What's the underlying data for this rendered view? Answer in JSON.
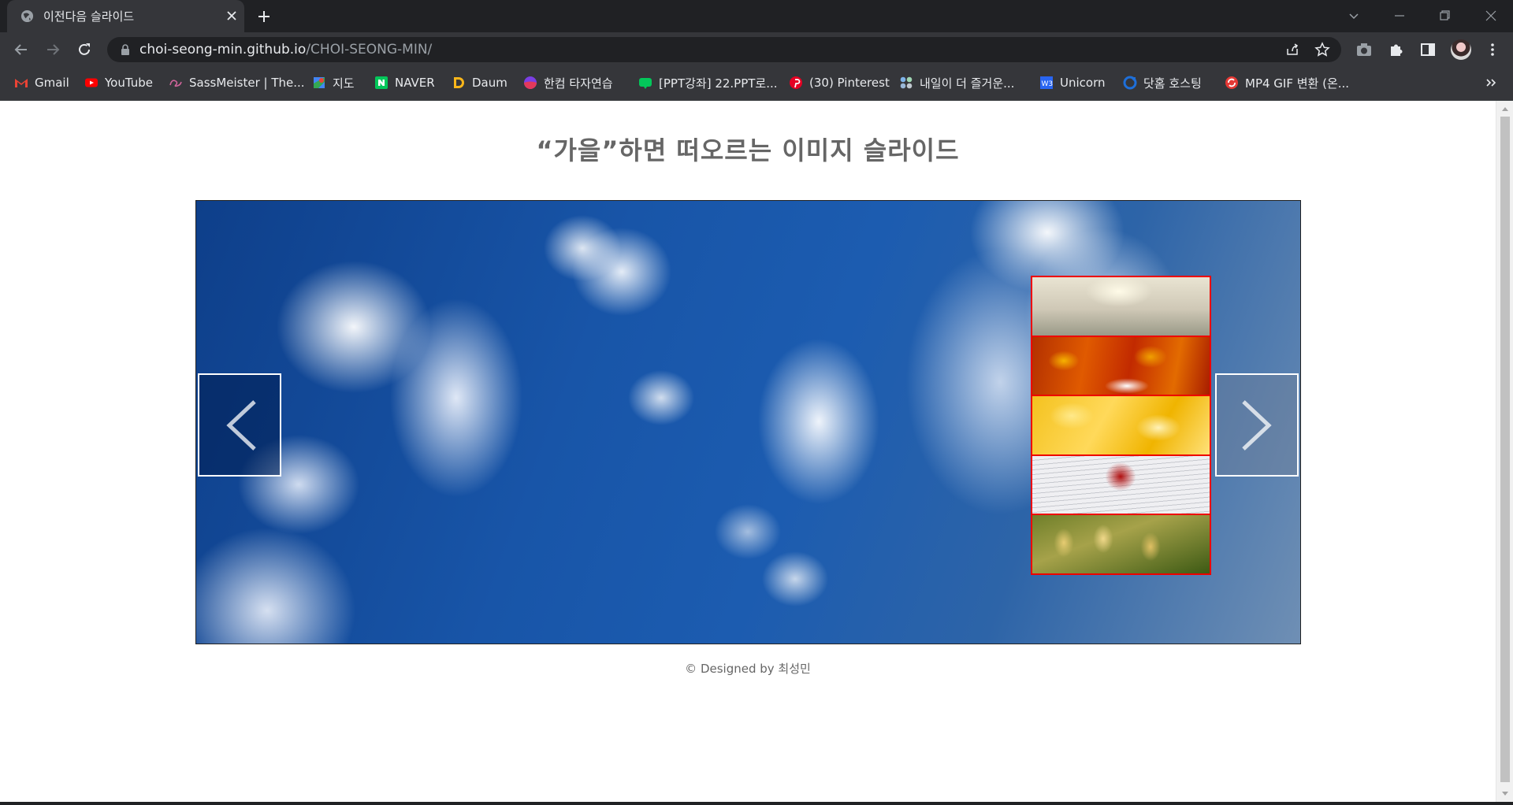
{
  "browser": {
    "tab_title": "이전다음 슬라이드",
    "url_host": "choi-seong-min.github.io",
    "url_path": "/CHOI-SEONG-MIN/",
    "bookmarks": [
      {
        "label": "Gmail",
        "icon": "gmail-icon",
        "color": "#ea4335"
      },
      {
        "label": "YouTube",
        "icon": "youtube-icon",
        "color": "#ff0000"
      },
      {
        "label": "SassMeister | The...",
        "icon": "sassmeister-icon",
        "color": "#cf649a"
      },
      {
        "label": "지도",
        "icon": "maps-icon",
        "color": "#34a853"
      },
      {
        "label": "NAVER",
        "icon": "naver-icon",
        "color": "#03c75a"
      },
      {
        "label": "Daum",
        "icon": "daum-icon",
        "color": "#f9b61a"
      },
      {
        "label": "한컴 타자연습",
        "icon": "hancom-icon",
        "color": "#7b3fe4"
      },
      {
        "label": "[PPT강좌] 22.PPT로...",
        "icon": "blog-icon",
        "color": "#03c75a"
      },
      {
        "label": "(30) Pinterest",
        "icon": "pinterest-icon",
        "color": "#e60023"
      },
      {
        "label": "내일이 더 즐거운...",
        "icon": "dots-app-icon",
        "color": "#7fb3e8"
      },
      {
        "label": "Unicorn",
        "icon": "w3-icon",
        "color": "#2965f1"
      },
      {
        "label": "닷홈 호스팅",
        "icon": "dothome-icon",
        "color": "#1e6fd9"
      },
      {
        "label": "MP4 GIF 변환 (온...",
        "icon": "convert-icon",
        "color": "#e53935"
      }
    ]
  },
  "page": {
    "title": "“가을”하면 떠오르는 이미지 슬라이드",
    "footer": "© Designed by 최성민"
  },
  "slider": {
    "current_slide": "sky-clouds",
    "thumbnails": [
      "sunlight-haze",
      "autumn-leaves",
      "ginkgo-yellow",
      "maple-leaf-book",
      "golden-grain"
    ],
    "accent_border": "#e00000"
  }
}
